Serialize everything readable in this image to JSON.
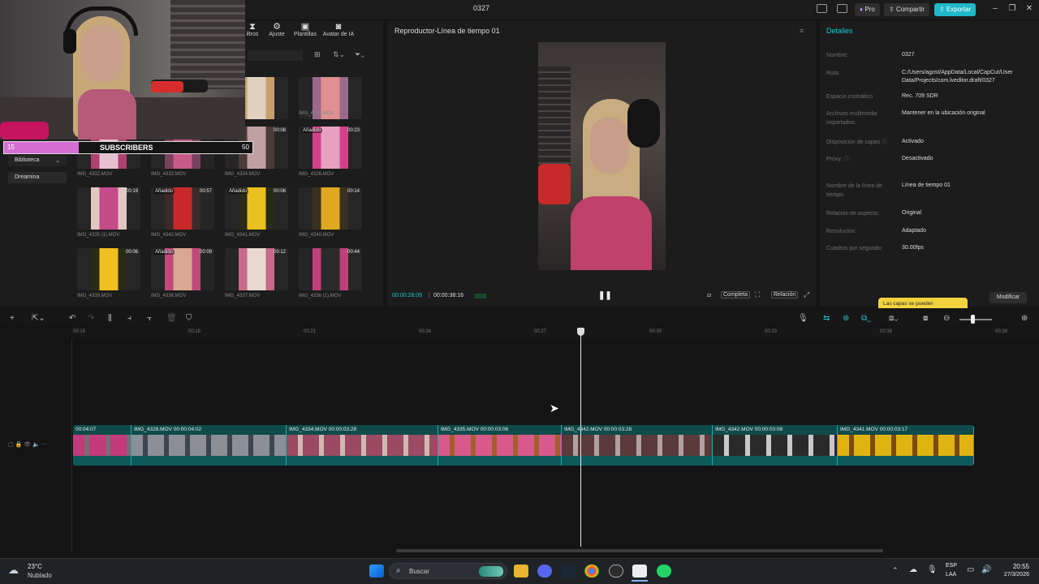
{
  "window": {
    "title": "0327",
    "pro": "Pro",
    "share": "Compartir",
    "export": "Exportar"
  },
  "stream_overlay": {
    "sub_start": "15",
    "sub_label": "SUBSCRIBERS",
    "sub_goal": "50"
  },
  "media_tabs": [
    {
      "label": "iltros",
      "icon": "filters-icon"
    },
    {
      "label": "Ajuste",
      "icon": "adjust-icon"
    },
    {
      "label": "Plantillas",
      "icon": "templates-icon"
    },
    {
      "label": "Avatar de IA",
      "icon": "ai-avatar-icon"
    }
  ],
  "sidebar": {
    "items": [
      "Biblioteca",
      "Dreamina"
    ]
  },
  "media": [
    {
      "name": "",
      "dur": "",
      "tag": ""
    },
    {
      "name": "",
      "dur": "",
      "tag": ""
    },
    {
      "name": "30.MOV",
      "dur": "",
      "tag": ""
    },
    {
      "name": "IMG_4331.MOV",
      "dur": "",
      "tag": ""
    },
    {
      "name": "IMG_4332.MOV",
      "dur": "",
      "tag": ""
    },
    {
      "name": "IMG_4333.MOV",
      "dur": "",
      "tag": ""
    },
    {
      "name": "IMG_4334.MOV",
      "dur": "00:08",
      "tag": ""
    },
    {
      "name": "IMG_4326.MOV",
      "dur": "00:23",
      "tag": "Añadido"
    },
    {
      "name": "IMG_4335 (1).MOV",
      "dur": "00:19",
      "tag": ""
    },
    {
      "name": "IMG_4342.MOV",
      "dur": "00:57",
      "tag": "Añadido"
    },
    {
      "name": "IMG_4341.MOV",
      "dur": "00:06",
      "tag": "Añadido"
    },
    {
      "name": "IMG_4340.MOV",
      "dur": "00:14",
      "tag": ""
    },
    {
      "name": "IMG_4339.MOV",
      "dur": "00:06",
      "tag": ""
    },
    {
      "name": "IMG_4338.MOV",
      "dur": "00:09",
      "tag": "Añadido"
    },
    {
      "name": "IMG_4337.MOV",
      "dur": "00:12",
      "tag": ""
    },
    {
      "name": "IMG_4336 (1).MOV",
      "dur": "00:44",
      "tag": ""
    }
  ],
  "player": {
    "title": "Reproductor-Línea de tiempo 01",
    "current_time": "00:00:28:09",
    "total_time": "00:00:38:16",
    "btn_completa": "Completa",
    "btn_relacion": "Relación"
  },
  "details": {
    "title": "Detalles",
    "rows": [
      {
        "k": "Nombre:",
        "v": "0327"
      },
      {
        "k": "Ruta:",
        "v": "C:/Users/agost/AppData/Local/CapCut/User Data/Projects/com.lveditor.draft/0327"
      },
      {
        "k": "Espacio cromático",
        "v": "Rec. 709 SDR"
      },
      {
        "k": "Archivos multimedia importados:",
        "v": "Mantener en la ubicación original"
      },
      {
        "k": "Disposición de capas ⓘ",
        "v": "Activado"
      },
      {
        "k": "Proxy: ⓘ",
        "v": "Desactivado"
      },
      {
        "k": "Nombre de la línea de tiempo",
        "v": "Línea de tiempo 01"
      },
      {
        "k": "Relación de aspecto:",
        "v": "Original"
      },
      {
        "k": "Resolución:",
        "v": "Adaptado"
      },
      {
        "k": "Cuadros por segundo:",
        "v": "30.00fps"
      }
    ],
    "modify": "Modificar",
    "tooltip": "Las capas se pueden"
  },
  "ruler": [
    "00:15",
    "00:18",
    "00:21",
    "00:24",
    "00:27",
    "00:30",
    "00:33",
    "00:36",
    "00:39"
  ],
  "clips": [
    {
      "label": "00:04:07",
      "colors": [
        "#c23a7a",
        "#7d6a73"
      ]
    },
    {
      "label": "IMG_4328.MOV  00:00:04:02",
      "colors": [
        "#8c8f95",
        "#3d4550"
      ]
    },
    {
      "label": "IMG_4334.MOV  00:00:03:28",
      "colors": [
        "#9b4a63",
        "#d0b8b0"
      ]
    },
    {
      "label": "IMG_4335.MOV  00:00:03:06",
      "colors": [
        "#d85a8a",
        "#a35e2e"
      ]
    },
    {
      "label": "IMG_4342.MOV  00:00:03:28",
      "colors": [
        "#5a3a3a",
        "#b0a0a0"
      ]
    },
    {
      "label": "IMG_4342.MOV  00:00:03:08",
      "colors": [
        "#2a2a2a",
        "#c8c8c8"
      ]
    },
    {
      "label": "IMG_4341.MOV  00:00:03:17",
      "colors": [
        "#e0b410",
        "#7a4a10"
      ]
    }
  ],
  "taskbar": {
    "weather_temp": "23°C",
    "weather_desc": "Nublado",
    "search": "Buscar",
    "lang1": "ESP",
    "lang2": "LAA",
    "time": "20:55",
    "date": "27/3/2026"
  },
  "colors": {
    "accent": "#1fb8c8",
    "subscribers": "#d66ed6",
    "tooltip": "#f3d33e"
  }
}
